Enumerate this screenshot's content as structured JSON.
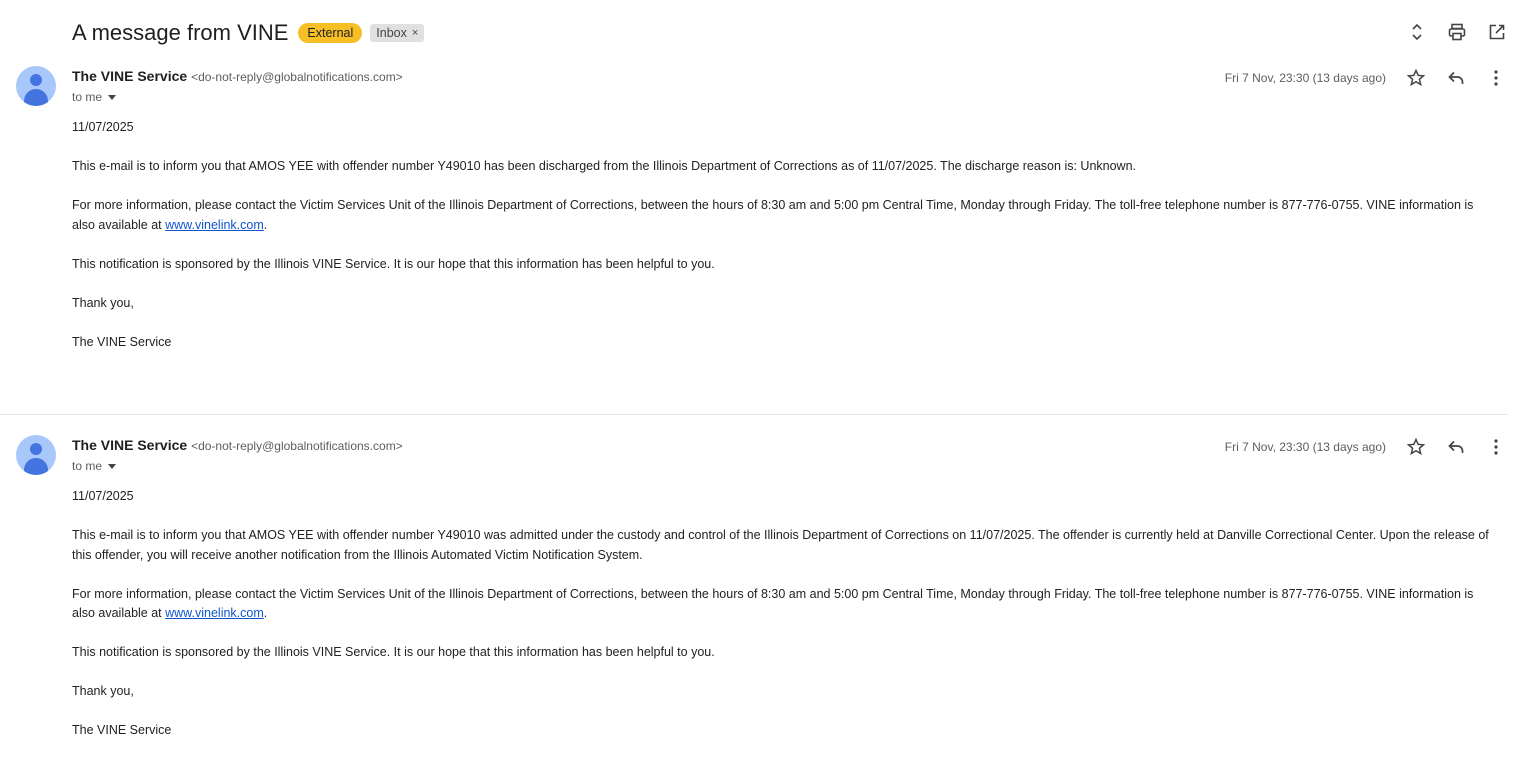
{
  "subject": "A message from VINE",
  "labels": {
    "external": "External",
    "inbox": "Inbox",
    "remove": "×"
  },
  "toolbar": {
    "expand_icon": "expand-collapse-icon",
    "print_icon": "print-icon",
    "open_icon": "open-in-new-window-icon"
  },
  "messages": [
    {
      "sender_name": "The VINE Service",
      "sender_email": "<do-not-reply@globalnotifications.com>",
      "to": "to me",
      "date": "Fri 7 Nov, 23:30 (13 days ago)",
      "body": {
        "date_line": "11/07/2025",
        "p1": "This e-mail is to inform you that AMOS YEE with offender number Y49010 has been discharged from the Illinois Department of Corrections as of 11/07/2025. The discharge reason is: Unknown.",
        "p2_pre": "For more information, please contact the Victim Services Unit of the Illinois Department of Corrections, between the hours of 8:30 am and 5:00 pm Central Time, Monday through Friday. The toll-free telephone number is 877-776-0755. VINE information is also available at ",
        "link": "www.vinelink.com",
        "p2_post": ".",
        "p3": "This notification is sponsored by the Illinois VINE Service. It is our hope that this information has been helpful to you.",
        "thanks": "Thank you,",
        "signature": "The VINE Service"
      }
    },
    {
      "sender_name": "The VINE Service",
      "sender_email": "<do-not-reply@globalnotifications.com>",
      "to": "to me",
      "date": "Fri 7 Nov, 23:30 (13 days ago)",
      "body": {
        "date_line": "11/07/2025",
        "p1": "This e-mail is to inform you that AMOS YEE with offender number Y49010 was admitted under the custody and control of the Illinois Department of Corrections on 11/07/2025. The offender is currently held at Danville Correctional Center. Upon the release of this offender, you will receive another notification from the Illinois Automated Victim Notification System.",
        "p2_pre": "For more information, please contact the Victim Services Unit of the Illinois Department of Corrections, between the hours of 8:30 am and 5:00 pm Central Time, Monday through Friday. The toll-free telephone number is 877-776-0755. VINE information is also available at ",
        "link": "www.vinelink.com",
        "p2_post": ".",
        "p3": "This notification is sponsored by the Illinois VINE Service. It is our hope that this information has been helpful to you.",
        "thanks": "Thank you,",
        "signature": "The VINE Service"
      }
    }
  ],
  "colors": {
    "external_badge": "#f6bf26",
    "inbox_badge": "#e0e0e0",
    "link": "#1155cc",
    "avatar_bg": "#a8c7fa",
    "avatar_fg": "#4374e0"
  }
}
